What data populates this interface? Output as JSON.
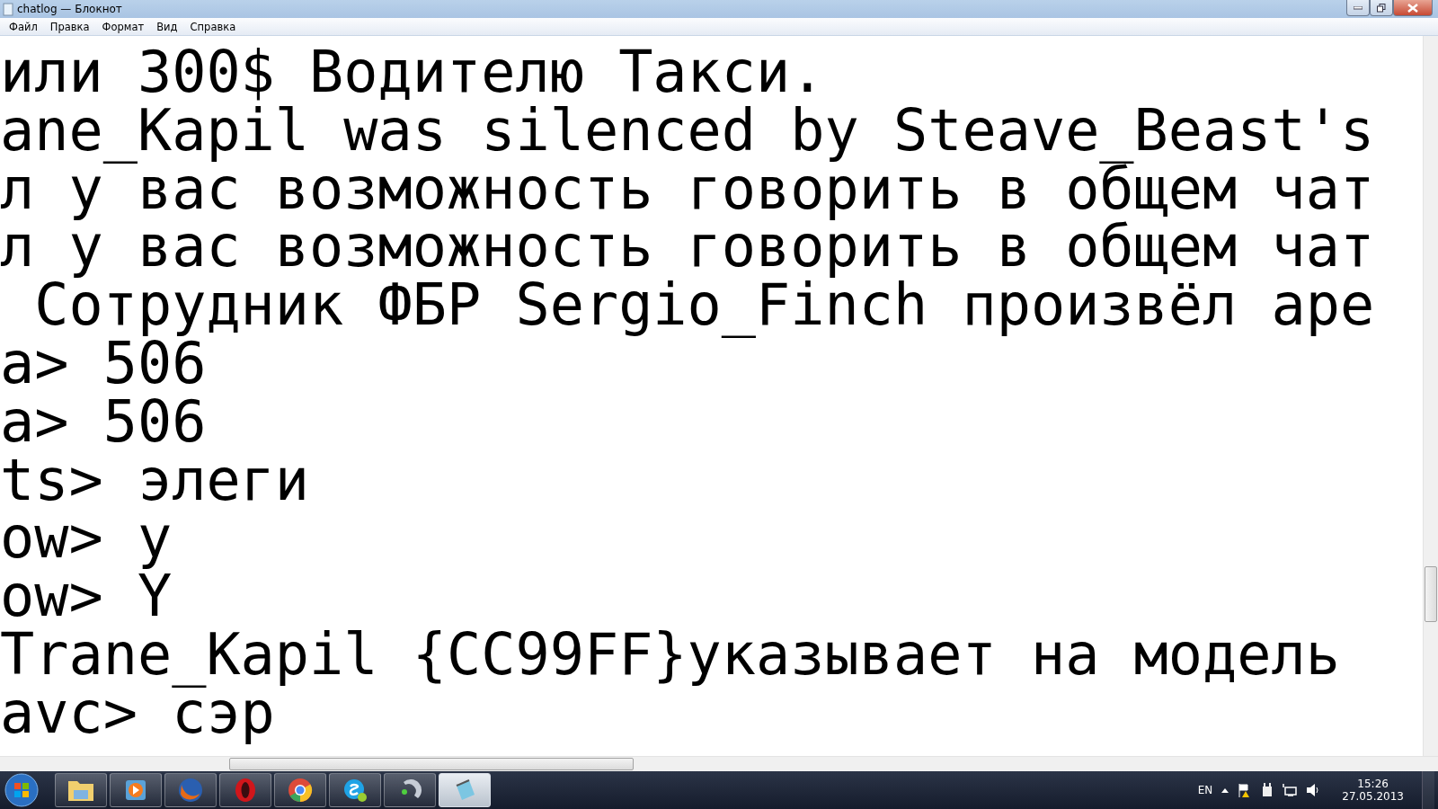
{
  "window": {
    "title": "chatlog — Блокнот"
  },
  "menu": [
    "Файл",
    "Правка",
    "Формат",
    "Вид",
    "Справка"
  ],
  "lines": [
    "или 300$ Водителю Такси.",
    "ane_Kapil was silenced by Steave_Beast's",
    "л у вас возможность говорить в общем чат",
    "л у вас возможность говорить в общем чат",
    " Сотрудник ФБР Sergio_Finch произвёл аре",
    "a> 506",
    "a> 506",
    "ts> элеги",
    "ow> у",
    "ow> Y",
    "Trane_Kapil {CC99FF}указывает на модель",
    "avc> сэр"
  ],
  "taskbar": {
    "apps": [
      {
        "kind": "folder",
        "selected": false
      },
      {
        "kind": "player",
        "selected": false
      },
      {
        "kind": "firefox",
        "selected": false
      },
      {
        "kind": "opera",
        "selected": false
      },
      {
        "kind": "chrome",
        "selected": false
      },
      {
        "kind": "skype",
        "selected": false
      },
      {
        "kind": "teamspeak",
        "selected": false
      },
      {
        "kind": "notepad",
        "selected": true
      }
    ],
    "language": "EN",
    "time": "15:26",
    "date": "27.05.2013"
  }
}
